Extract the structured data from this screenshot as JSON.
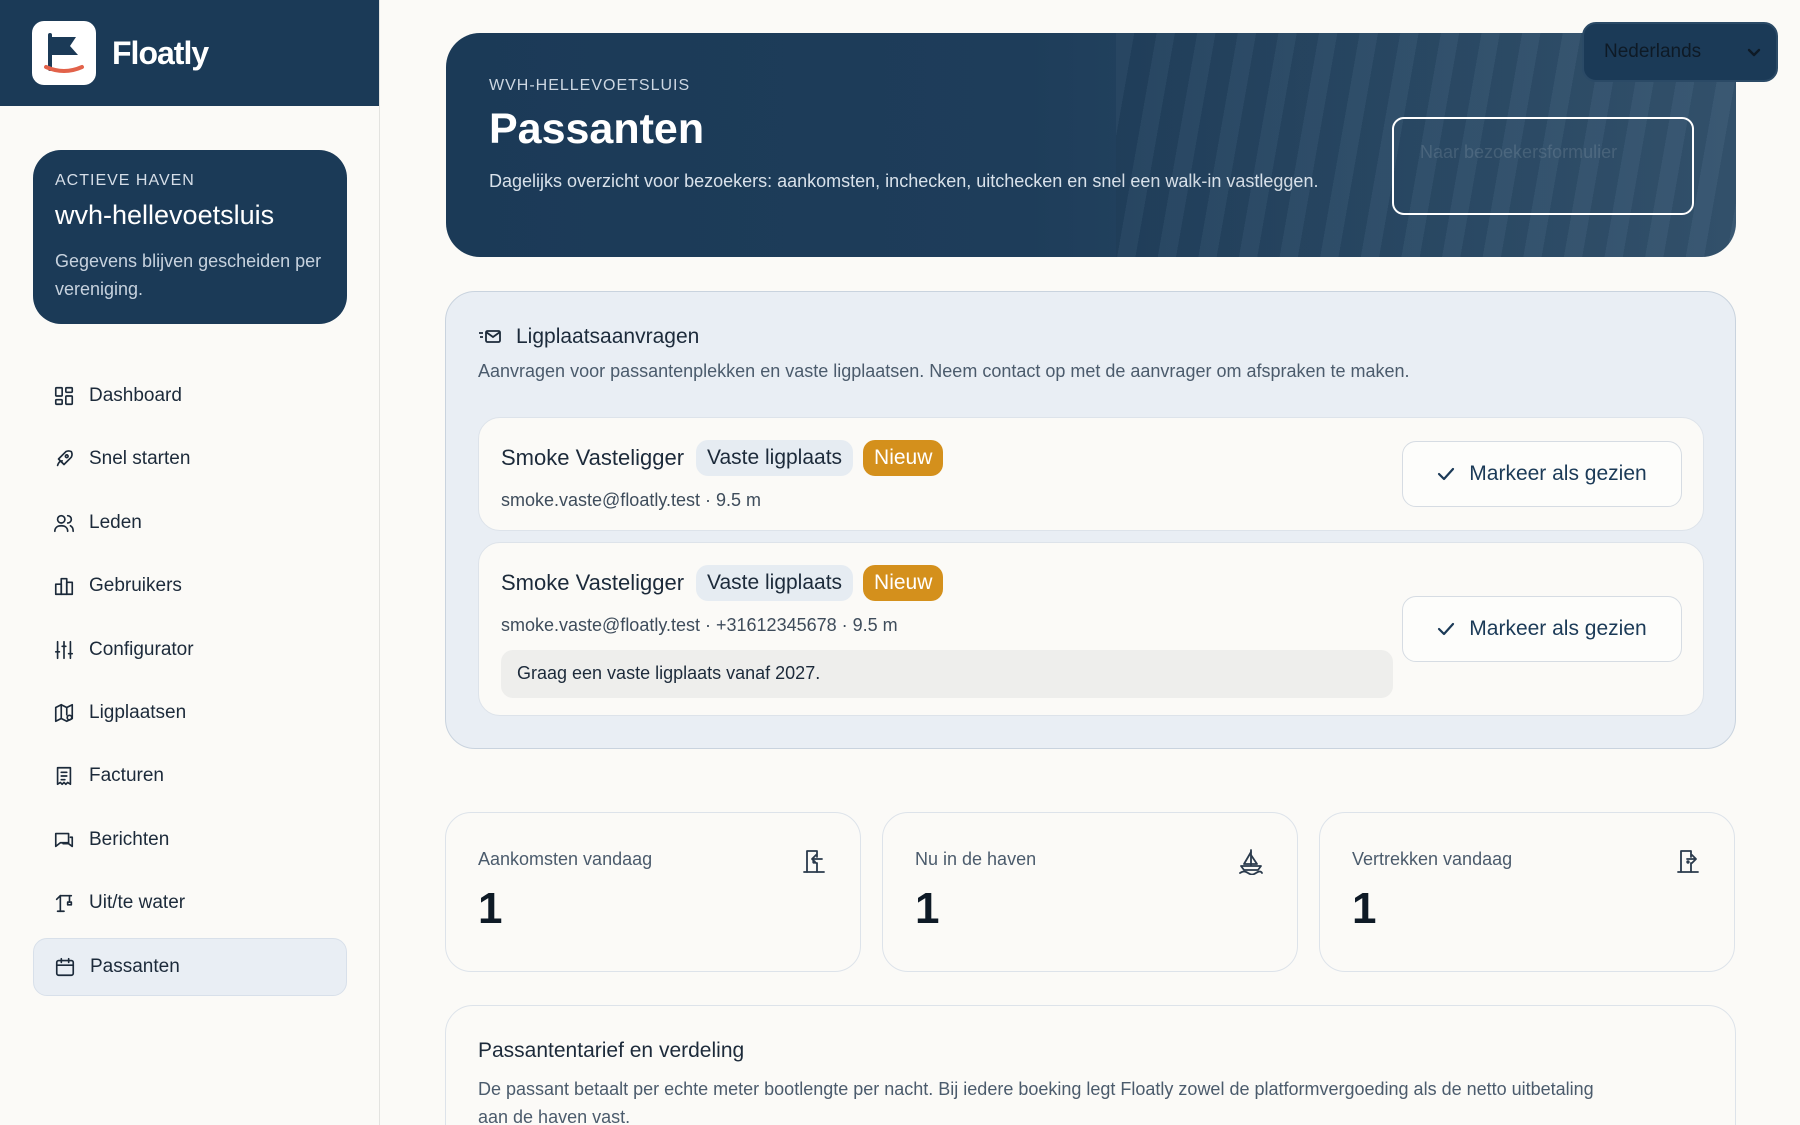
{
  "app": {
    "name": "Floatly"
  },
  "harbor": {
    "label": "ACTIEVE HAVEN",
    "name": "wvh-hellevoetsluis",
    "description": "Gegevens blijven gescheiden per vereniging."
  },
  "nav": {
    "items": [
      {
        "label": "Dashboard",
        "icon": "grid-icon"
      },
      {
        "label": "Snel starten",
        "icon": "rocket-icon"
      },
      {
        "label": "Leden",
        "icon": "users-icon"
      },
      {
        "label": "Gebruikers",
        "icon": "building-icon"
      },
      {
        "label": "Configurator",
        "icon": "sliders-icon"
      },
      {
        "label": "Ligplaatsen",
        "icon": "map-icon"
      },
      {
        "label": "Facturen",
        "icon": "receipt-icon"
      },
      {
        "label": "Berichten",
        "icon": "message-icon"
      },
      {
        "label": "Uit/te water",
        "icon": "crane-icon"
      },
      {
        "label": "Passanten",
        "icon": "calendar-icon",
        "active": true
      }
    ]
  },
  "language": {
    "selected": "Nederlands"
  },
  "hero": {
    "kicker": "WVH-HELLEVOETSLUIS",
    "title": "Passanten",
    "subtitle": "Dagelijks overzicht voor bezoekers: aankomsten, inchecken, uitchecken en snel een walk-in vastleggen.",
    "button_label": "Naar bezoekersformulier"
  },
  "requests": {
    "title": "Ligplaatsaanvragen",
    "subtitle": "Aanvragen voor passantenplekken en vaste ligplaatsen. Neem contact op met de aanvrager om afspraken te maken.",
    "items": [
      {
        "name": "Smoke Vasteligger",
        "type": "Vaste ligplaats",
        "status": "Nieuw",
        "meta": "smoke.vaste@floatly.test · 9.5 m",
        "note": "",
        "action": "Markeer als gezien"
      },
      {
        "name": "Smoke Vasteligger",
        "type": "Vaste ligplaats",
        "status": "Nieuw",
        "meta": "smoke.vaste@floatly.test · +31612345678 · 9.5 m",
        "note": "Graag een vaste ligplaats vanaf 2027.",
        "action": "Markeer als gezien"
      }
    ]
  },
  "stats": [
    {
      "label": "Aankomsten vandaag",
      "value": "1",
      "icon": "door-in-icon"
    },
    {
      "label": "Nu in de haven",
      "value": "1",
      "icon": "sailboat-icon"
    },
    {
      "label": "Vertrekken vandaag",
      "value": "1",
      "icon": "door-out-icon"
    }
  ],
  "tariff": {
    "title": "Passantentarief en verdeling",
    "description": "De passant betaalt per echte meter bootlengte per nacht. Bij iedere boeking legt Floatly zowel de platformvergoeding als de netto uitbetaling aan de haven vast."
  },
  "colors": {
    "primary": "#1b3a57",
    "accent_badge": "#d4901c",
    "background": "#fbfaf7"
  }
}
